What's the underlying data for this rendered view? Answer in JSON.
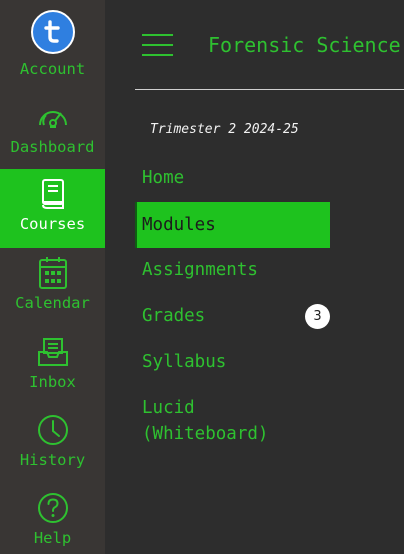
{
  "global_nav": {
    "items": [
      {
        "label": "Account",
        "icon": "avatar",
        "avatar_letter": "t"
      },
      {
        "label": "Dashboard",
        "icon": "speedometer-icon"
      },
      {
        "label": "Courses",
        "icon": "book-icon",
        "active": true
      },
      {
        "label": "Calendar",
        "icon": "calendar-icon"
      },
      {
        "label": "Inbox",
        "icon": "inbox-icon"
      },
      {
        "label": "History",
        "icon": "clock-icon"
      },
      {
        "label": "Help",
        "icon": "help-icon"
      }
    ]
  },
  "header": {
    "course_title": "Forensic Science"
  },
  "term": "Trimester 2 2024-25",
  "course_nav": {
    "items": [
      {
        "label": "Home"
      },
      {
        "label": "Modules",
        "active": true
      },
      {
        "label": "Assignments"
      },
      {
        "label": "Grades",
        "badge": "3"
      },
      {
        "label": "Syllabus"
      },
      {
        "label": "Lucid (Whiteboard)"
      }
    ]
  },
  "colors": {
    "accent": "#1ec21e",
    "nav_bg": "#393634",
    "main_bg": "#2d2d2d",
    "avatar": "#2f7fe0"
  }
}
